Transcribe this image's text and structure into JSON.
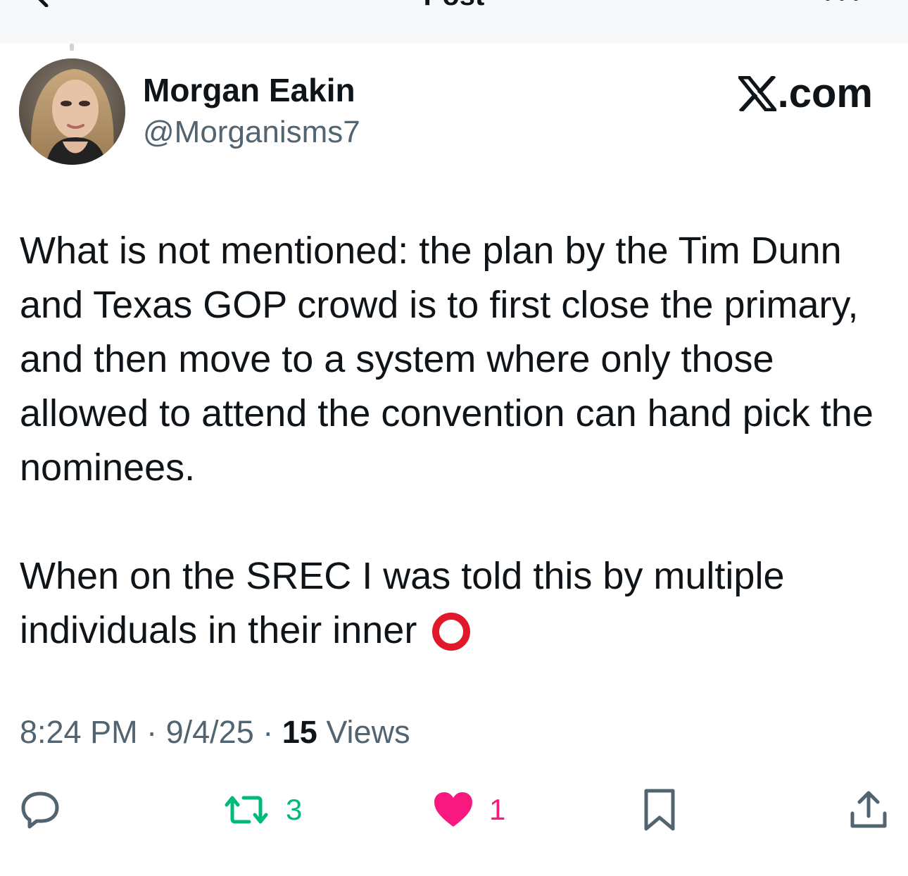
{
  "nav": {
    "title": "Post"
  },
  "author": {
    "display_name": "Morgan Eakin",
    "handle": "@Morganisms7"
  },
  "brand": {
    "text": ".com"
  },
  "post": {
    "paragraph_1": "What is not mentioned: the plan by the Tim Dunn and Texas GOP crowd is to first close the primary, and then move to a system where only those allowed to attend the convention can hand pick the nominees.",
    "paragraph_2": "When on the SREC I was told this by multiple individuals in their inner"
  },
  "meta": {
    "time": "8:24 PM",
    "separator": "·",
    "date": "9/4/25",
    "views_count": "15",
    "views_label": "Views"
  },
  "actions": {
    "reposts": "3",
    "likes": "1"
  },
  "colors": {
    "text": "#0f1419",
    "secondary": "#536471",
    "repost_green": "#00ba7c",
    "like_pink": "#f91880",
    "emoji_red": "#e0182b"
  },
  "icons": [
    "back-chevron-icon",
    "more-icon",
    "x-logo-icon",
    "hollow-red-circle-emoji",
    "reply-icon",
    "repost-icon",
    "heart-icon",
    "bookmark-icon",
    "share-icon"
  ]
}
